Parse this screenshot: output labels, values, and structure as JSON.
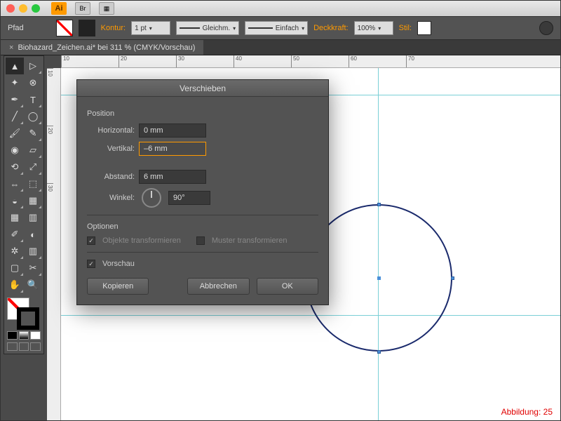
{
  "titlebar": {
    "logo": "Ai",
    "btn1": "Br"
  },
  "control": {
    "path": "Pfad",
    "kontur": "Kontur:",
    "stroke_weight": "1 pt",
    "profile": "Gleichm.",
    "brush": "Einfach",
    "opacity_lbl": "Deckkraft:",
    "opacity_val": "100%",
    "style_lbl": "Stil:"
  },
  "tab": {
    "name": "Biohazard_Zeichen.ai* bei 311 % (CMYK/Vorschau)"
  },
  "ruler": {
    "h": [
      "10",
      "20",
      "30",
      "40",
      "50",
      "60",
      "70"
    ],
    "v": [
      "10",
      "20",
      "30"
    ]
  },
  "dialog": {
    "title": "Verschieben",
    "section_position": "Position",
    "horizontal_lbl": "Horizontal:",
    "horizontal_val": "0 mm",
    "vertical_lbl": "Vertikal:",
    "vertical_val": "–6 mm",
    "distance_lbl": "Abstand:",
    "distance_val": "6 mm",
    "angle_lbl": "Winkel:",
    "angle_val": "90°",
    "section_options": "Optionen",
    "opt_objects": "Objekte transformieren",
    "opt_patterns": "Muster transformieren",
    "preview": "Vorschau",
    "copy": "Kopieren",
    "cancel": "Abbrechen",
    "ok": "OK"
  },
  "caption": "Abbildung: 25",
  "tools": {
    "select": "selection",
    "direct": "direct-select",
    "wand": "magic-wand",
    "lasso": "lasso",
    "pen": "pen",
    "type": "type",
    "line": "line",
    "ellipse": "ellipse",
    "brush": "brush",
    "pencil": "pencil",
    "blob": "blob-brush",
    "eraser": "eraser",
    "rotate": "rotate",
    "scale": "scale",
    "width": "width",
    "warp": "free-transform",
    "shapebuilder": "shape-builder",
    "perspective": "perspective",
    "mesh": "mesh",
    "gradient": "gradient",
    "eyedrop": "eyedropper",
    "blend": "blend",
    "symbol": "symbol-sprayer",
    "graph": "column-graph",
    "artboard": "artboard",
    "slice": "slice",
    "hand": "hand",
    "zoom": "zoom"
  }
}
